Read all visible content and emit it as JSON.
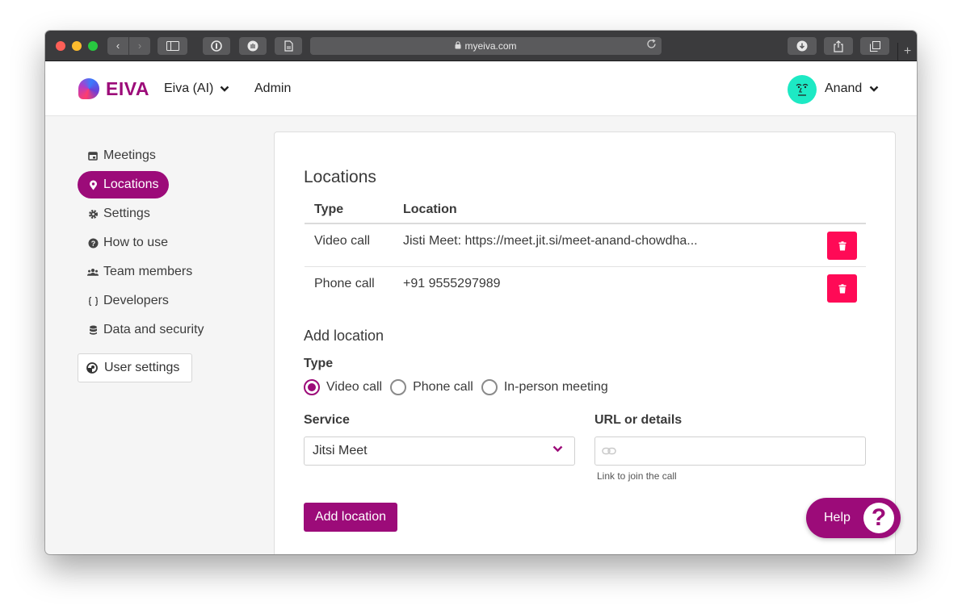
{
  "browser": {
    "url": "myeiva.com",
    "back_glyph": "‹",
    "forward_glyph": "›",
    "newtab_glyph": "+"
  },
  "header": {
    "logo_text": "EIVA",
    "org_label": "Eiva (AI)",
    "admin_label": "Admin",
    "user_name": "Anand"
  },
  "sidebar": {
    "items": [
      {
        "label": "Meetings",
        "icon": "calendar-icon"
      },
      {
        "label": "Locations",
        "icon": "location-pin-icon"
      },
      {
        "label": "Settings",
        "icon": "gear-icon"
      },
      {
        "label": "How to use",
        "icon": "question-circle-icon"
      },
      {
        "label": "Team members",
        "icon": "users-icon"
      },
      {
        "label": "Developers",
        "icon": "code-braces-icon"
      },
      {
        "label": "Data and security",
        "icon": "database-icon"
      }
    ],
    "active_index": 1,
    "user_settings_label": "User settings"
  },
  "locations": {
    "heading": "Locations",
    "columns": [
      "Type",
      "Location"
    ],
    "rows": [
      {
        "type": "Video call",
        "location": "Jisti Meet: https://meet.jit.si/meet-anand-chowdha..."
      },
      {
        "type": "Phone call",
        "location": "+91 9555297989"
      }
    ]
  },
  "add_location": {
    "heading": "Add location",
    "type_label": "Type",
    "options": [
      "Video call",
      "Phone call",
      "In-person meeting"
    ],
    "selected_option": "Video call",
    "service_label": "Service",
    "service_value": "Jitsi Meet",
    "url_label": "URL or details",
    "url_value": "",
    "url_hint": "Link to join the call",
    "submit_label": "Add location"
  },
  "help": {
    "label": "Help",
    "glyph": "?"
  },
  "colors": {
    "brand": "#9c0b79",
    "danger": "#ff0a56",
    "avatar": "#1de9c4"
  }
}
